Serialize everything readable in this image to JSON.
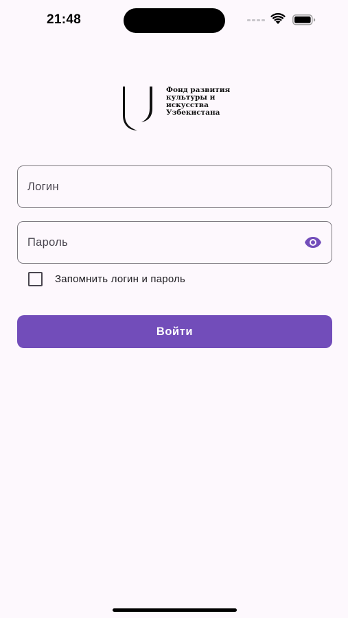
{
  "status_bar": {
    "time": "21:48",
    "signal_icon": "cellular-signal-icon",
    "wifi_icon": "wifi-icon",
    "battery_icon": "battery-icon"
  },
  "logo": {
    "icon": "foundation-logo-icon",
    "lines": [
      "Фонд развития",
      "культуры и",
      "искусства",
      "Узбекистана"
    ]
  },
  "form": {
    "login_placeholder": "Логин",
    "login_value": "",
    "password_placeholder": "Пароль",
    "password_value": "",
    "password_toggle_icon": "eye-icon",
    "remember_label": "Запомнить логин и пароль",
    "remember_checked": false,
    "submit_label": "Войти"
  },
  "colors": {
    "accent": "#724dba",
    "background": "#fdf8fd",
    "outline": "#7d7a80"
  }
}
